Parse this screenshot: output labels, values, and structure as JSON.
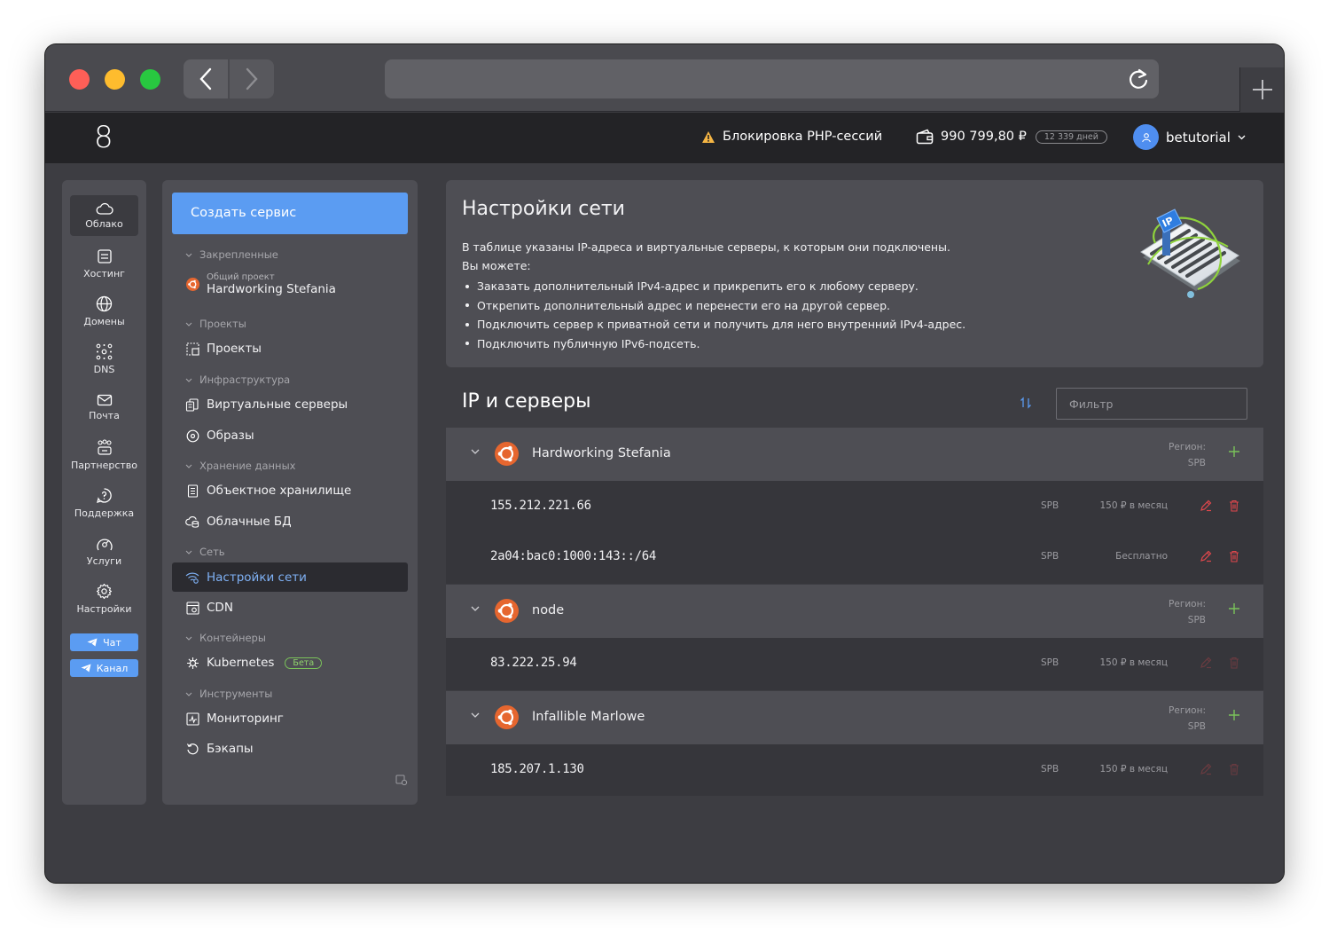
{
  "header": {
    "logo": "8",
    "warning": "Блокировка PHP-сессий",
    "balance": "990 799,80 ₽",
    "days": "12 339 дней",
    "username": "betutorial"
  },
  "rail": {
    "items": [
      {
        "label": "Облако",
        "icon": "cloud-icon"
      },
      {
        "label": "Хостинг",
        "icon": "server-icon"
      },
      {
        "label": "Домены",
        "icon": "globe-icon"
      },
      {
        "label": "DNS",
        "icon": "dns-icon"
      },
      {
        "label": "Почта",
        "icon": "mail-icon"
      },
      {
        "label": "Партнерство",
        "icon": "partners-icon"
      },
      {
        "label": "Поддержка",
        "icon": "support-icon"
      },
      {
        "label": "Услуги",
        "icon": "services-icon"
      },
      {
        "label": "Настройки",
        "icon": "gear-icon"
      }
    ],
    "chat": "Чат",
    "channel": "Канал"
  },
  "menu": {
    "create": "Создать сервис",
    "pinned": "Закрепленные",
    "pinned_sub": "Общий проект",
    "pinned_item": "Hardworking Stefania",
    "projects_sec": "Проекты",
    "projects": "Проекты",
    "infra_sec": "Инфраструктура",
    "vservers": "Виртуальные серверы",
    "images": "Образы",
    "storage_sec": "Хранение данных",
    "object_storage": "Объектное хранилище",
    "cloud_db": "Облачные БД",
    "net_sec": "Сеть",
    "net_settings": "Настройки сети",
    "cdn": "CDN",
    "containers_sec": "Контейнеры",
    "kubernetes": "Kubernetes",
    "beta": "Бета",
    "tools_sec": "Инструменты",
    "monitoring": "Мониторинг",
    "backups": "Бэкапы"
  },
  "panel": {
    "title": "Настройки сети",
    "desc": "В таблице указаны IP-адреса и виртуальные серверы, к которым они подключены.",
    "you_can": "Вы можете:",
    "bullets": [
      "Заказать дополнительный IPv4-адрес и прикрепить его к любому серверу.",
      "Открепить дополнительный адрес и перенести его на другой сервер.",
      "Подключить сервер к приватной сети и получить для него внутренний IPv4-адрес.",
      "Подключить публичную IPv6-подсеть."
    ],
    "badge": "IP"
  },
  "list": {
    "title": "IP и серверы",
    "filter_placeholder": "Фильтр",
    "region_label": "Регион:",
    "groups": [
      {
        "name": "Hardworking Stefania",
        "region": "SPB",
        "rows": [
          {
            "ip": "155.212.221.66",
            "region": "SPB",
            "price": "150 ₽ в месяц"
          },
          {
            "ip": "2a04:bac0:1000:143::/64",
            "region": "SPB",
            "price": "Бесплатно"
          }
        ]
      },
      {
        "name": "node",
        "region": "SPB",
        "rows": [
          {
            "ip": "83.222.25.94",
            "region": "SPB",
            "price": "150 ₽ в месяц"
          }
        ]
      },
      {
        "name": "Infallible Marlowe",
        "region": "SPB",
        "rows": [
          {
            "ip": "185.207.1.130",
            "region": "SPB",
            "price": "150 ₽ в месяц"
          }
        ]
      }
    ]
  },
  "colors": {
    "accent": "#5b9cf2",
    "danger": "#e0474c",
    "success": "#7ac25a",
    "ubuntu": "#e6662f"
  }
}
